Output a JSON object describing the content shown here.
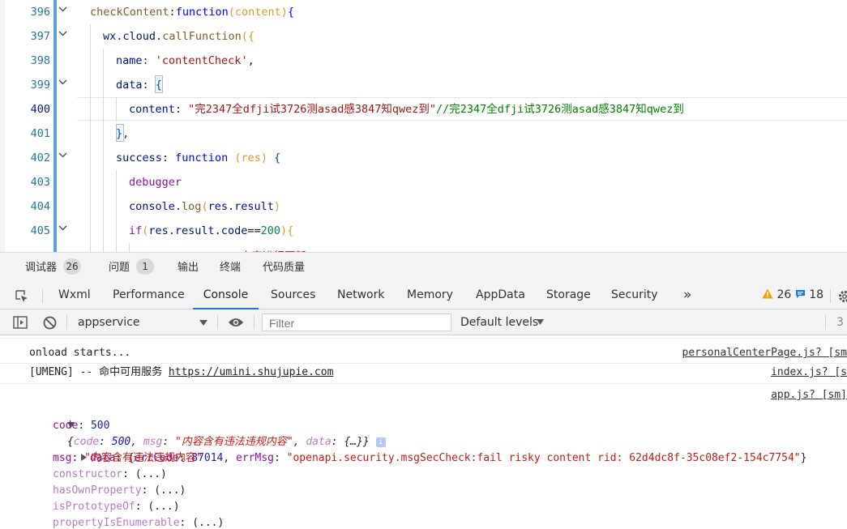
{
  "editor": {
    "lines": [
      {
        "num": "396",
        "fold": true
      },
      {
        "num": "397",
        "fold": true
      },
      {
        "num": "398",
        "fold": false
      },
      {
        "num": "399",
        "fold": true
      },
      {
        "num": "400",
        "fold": false
      },
      {
        "num": "401",
        "fold": false
      },
      {
        "num": "402",
        "fold": true
      },
      {
        "num": "403",
        "fold": false
      },
      {
        "num": "404",
        "fold": false
      },
      {
        "num": "405",
        "fold": true
      }
    ],
    "tokens": {
      "l396_name": "checkContent",
      "l396_colon": ":",
      "l396_kw": "function",
      "l396_paren_open": "(",
      "l396_param": "content",
      "l396_paren_close": ")",
      "l396_brace": "{",
      "l397_obj": "wx",
      "l397_dot1": ".",
      "l397_prop": "cloud",
      "l397_dot2": ".",
      "l397_fn": "callFunction",
      "l397_open": "({",
      "l398_key": "name",
      "l398_colon": ": ",
      "l398_str": "'contentCheck'",
      "l398_comma": ",",
      "l399_key": "data",
      "l399_colon": ": ",
      "l399_brace": "{",
      "l400_key": "content",
      "l400_colon": ": ",
      "l400_str": "\"完2347全dfji试3726测asad感3847知qwez到\"",
      "l400_comment": "//完2347全dfji试3726测asad感3847知qwez到",
      "l401_brace": "}",
      "l401_comma": ",",
      "l402_key": "success",
      "l402_colon": ": ",
      "l402_kw": "function",
      "l402_space": " ",
      "l402_paren_open": "(",
      "l402_param": "res",
      "l402_paren_close": ")",
      "l402_space2": " ",
      "l402_brace": "{",
      "l403_kw": "debugger",
      "l404_obj": "console",
      "l404_dot": ".",
      "l404_fn": "log",
      "l404_paren_open": "(",
      "l404_arg": "res.result",
      "l404_paren_close": ")",
      "l405_kw": "if",
      "l405_paren_open": "(",
      "l405_expr": "res.result.code",
      "l405_op": "==",
      "l405_num": "200",
      "l405_paren_close": ")",
      "l405_brace": "{",
      "l406_partial": "              …内容进行更新…"
    }
  },
  "panel_tabs": [
    {
      "label": "调试器",
      "badge": "26"
    },
    {
      "label": "问题",
      "badge": "1"
    },
    {
      "label": "输出"
    },
    {
      "label": "终端"
    },
    {
      "label": "代码质量"
    }
  ],
  "devtools_tabs": [
    "Wxml",
    "Performance",
    "Console",
    "Sources",
    "Network",
    "Memory",
    "AppData",
    "Storage",
    "Security"
  ],
  "devtools_active": "Console",
  "devtools_more": "»",
  "devtools_counts": {
    "warnings": "26",
    "messages": "18"
  },
  "colors": {
    "accent": "#1a73e8",
    "warning": "#e8a400",
    "message": "#1a73e8"
  },
  "console_toolbar": {
    "context": "appservice",
    "filter_placeholder": "Filter",
    "levels": "Default levels",
    "hidden_count": "3"
  },
  "console": {
    "messages": [
      {
        "text": "onload starts...",
        "source": "personalCenterPage.js? [sm"
      },
      {
        "text_prefix": "[UMENG] -- 命中可用服务 ",
        "link": "https://umini.shujupie.com",
        "source": "index.js? [s"
      },
      {
        "source": "app.js? [sm]"
      }
    ],
    "object": {
      "summary_open": "{",
      "summary_code_key": "code",
      "summary_code_val": "500",
      "summary_msg_key": "msg",
      "summary_msg_val": "\"内容含有违法违规内容\"",
      "summary_data_key": "data",
      "summary_data_val": "{…}",
      "summary_close": "}",
      "code_key": "code",
      "code_val": "500",
      "data_key": "data",
      "data_errcode_key": "errCode",
      "data_errcode_val": "87014",
      "data_errmsg_key": "errMsg",
      "data_errmsg_val": "\"openapi.security.msgSecCheck:fail risky content rid: 62d4dc8f-35c08ef2-154c7754\"",
      "msg_key": "msg",
      "msg_val": "\"内容含有违法违规内容\"",
      "proto": [
        {
          "key": "constructor",
          "val": "(...)"
        },
        {
          "key": "hasOwnProperty",
          "val": "(...)"
        },
        {
          "key": "isPrototypeOf",
          "val": "(...)"
        },
        {
          "key": "propertyIsEnumerable",
          "val": "(...)"
        }
      ]
    }
  }
}
